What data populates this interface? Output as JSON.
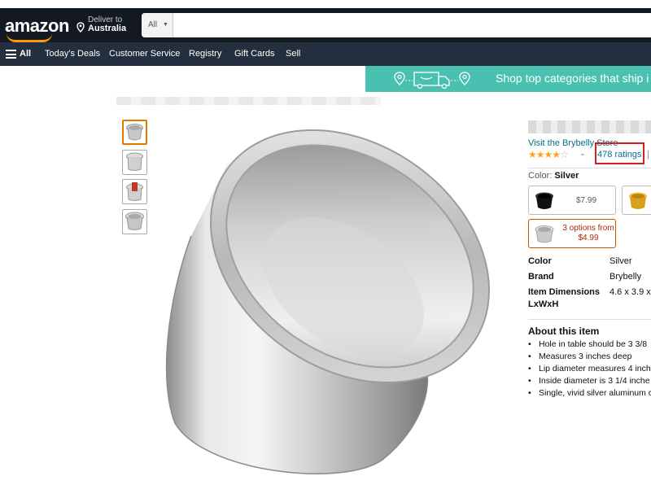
{
  "header": {
    "logo_text": "amazon",
    "deliver_line1": "Deliver to",
    "deliver_line2": "Australia",
    "search_category": "All",
    "search_value": "",
    "search_placeholder": ""
  },
  "nav": {
    "items": [
      {
        "label": "All"
      },
      {
        "label": "Today's Deals"
      },
      {
        "label": "Customer Service"
      },
      {
        "label": "Registry"
      },
      {
        "label": "Gift Cards"
      },
      {
        "label": "Sell"
      }
    ]
  },
  "banner": {
    "text": "Shop top categories that ship i",
    "color": "#4ac1b0"
  },
  "product": {
    "store_link": "Visit the Brybelly Store",
    "rating_stars": 4.5,
    "ratings_text": "478 ratings",
    "ratings_separator": "|",
    "color_label": "Color:",
    "color_value": "Silver",
    "swatches": [
      {
        "price": "$7.99",
        "color": "black"
      },
      {
        "price": "",
        "color": "gold"
      },
      {
        "options_line1": "3 options from",
        "options_line2": "$4.99",
        "color": "silver"
      }
    ],
    "specs": [
      {
        "key": "Color",
        "value": "Silver"
      },
      {
        "key": "Brand",
        "value": "Brybelly"
      },
      {
        "key": "Item Dimensions",
        "key2": "LxWxH",
        "value": "4.6 x 3.9 x 3"
      }
    ],
    "about_heading": "About this item",
    "bullets": [
      "Hole in table should be 3 3/8",
      "Measures 3 inches deep",
      "Lip diameter measures 4 inche",
      "Inside diameter is 3 1/4 inche",
      "Single, vivid silver aluminum c"
    ]
  },
  "colors": {
    "nav_belt": "#131921",
    "nav_main": "#232f3e",
    "link": "#007185",
    "star": "#ffa41c",
    "highlight": "#d81e1e"
  }
}
